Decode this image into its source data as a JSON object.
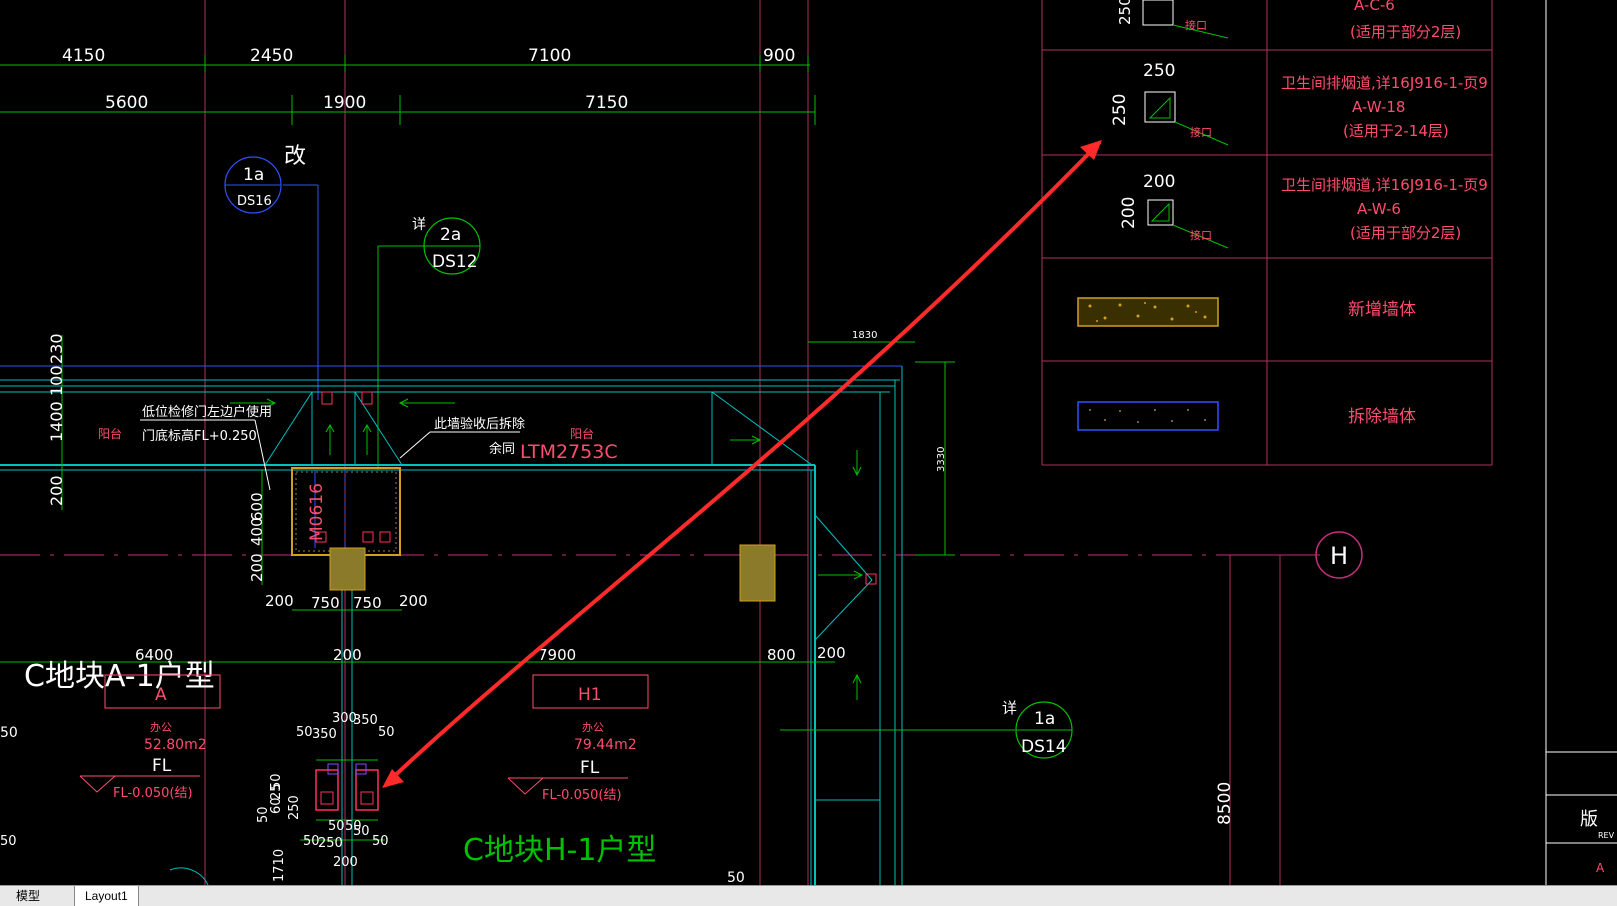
{
  "dims": {
    "top1": [
      "4150",
      "2450",
      "7100",
      "900"
    ],
    "top2": [
      "5600",
      "1900",
      "7150"
    ],
    "left_vertical": [
      "230",
      "100",
      "1400",
      "200"
    ],
    "left_vertical2": [
      "600",
      "400",
      "200"
    ],
    "door_dims": [
      "200",
      "750",
      "750",
      "200"
    ],
    "mid_dims": [
      "6400",
      "200",
      "7900",
      "800",
      "200"
    ],
    "dim_1830": "1830",
    "dim_3330": "3330",
    "dim_8500": "8500",
    "shaft_dims": [
      "300",
      "350",
      "50",
      "350",
      "50",
      "50",
      "25",
      "60",
      "50",
      "50",
      "250",
      "50",
      "50",
      "50",
      "250",
      "200",
      "50",
      "1710",
      "50"
    ]
  },
  "callouts": {
    "c1": {
      "top": "1a",
      "bottom": "DS16",
      "note": "改"
    },
    "c2": {
      "top": "2a",
      "bottom": "DS12",
      "note": "详"
    },
    "c3": {
      "top": "1a",
      "bottom": "DS14",
      "note": "详"
    },
    "grid_h": "H"
  },
  "annotations": {
    "low_door_1": "低位检修门左边户使用",
    "low_door_2": "门底标高FL+0.250",
    "balcony_left": "阳台",
    "balcony_right": "阳台",
    "wall_demo": "此墙验收后拆除",
    "same": "余同",
    "window_code": "LTM2753C",
    "door_code": "M0616"
  },
  "units": {
    "a": {
      "name": "C地块A-1户型",
      "tag": "A",
      "use": "办公",
      "area": "52.80m2",
      "fl": "FL",
      "level": "FL-0.050(结)"
    },
    "h": {
      "name": "C地块H-1户型",
      "tag": "H1",
      "use": "办公",
      "area": "79.44m2",
      "fl": "FL",
      "level": "FL-0.050(结)"
    }
  },
  "legend": {
    "row0_spec": "A-C-6",
    "row0_note": "(适用于部分2层)",
    "row0_dim": "250",
    "row0_lbl": "接口",
    "row1_dim_top": "250",
    "row1_dim_left": "250",
    "row1_lbl": "接口",
    "row1_l1": "卫生间排烟道,详16J916-1-页9",
    "row1_l2": "A-W-18",
    "row1_l3": "(适用于2-14层)",
    "row2_dim_top": "200",
    "row2_dim_left": "200",
    "row2_lbl": "接口",
    "row2_l1": "卫生间排烟道,详16J916-1-页9",
    "row2_l2": "A-W-6",
    "row2_l3": "(适用于部分2层)",
    "row3": "新增墙体",
    "row4": "拆除墙体"
  },
  "titleblock": {
    "ban": "版",
    "rev": "REV",
    "a": "A"
  },
  "misc_50": "50",
  "tabs": {
    "model": "模型",
    "layout": "Layout1"
  },
  "colors": {
    "bg": "#000000",
    "dim": "#00ff00",
    "text_white": "#ffffff",
    "text_pink": "#ff4d6d",
    "wall_cyan": "#00c0c0",
    "arrow": "#ff2a2a",
    "grid_magenta": "#c0307a"
  }
}
